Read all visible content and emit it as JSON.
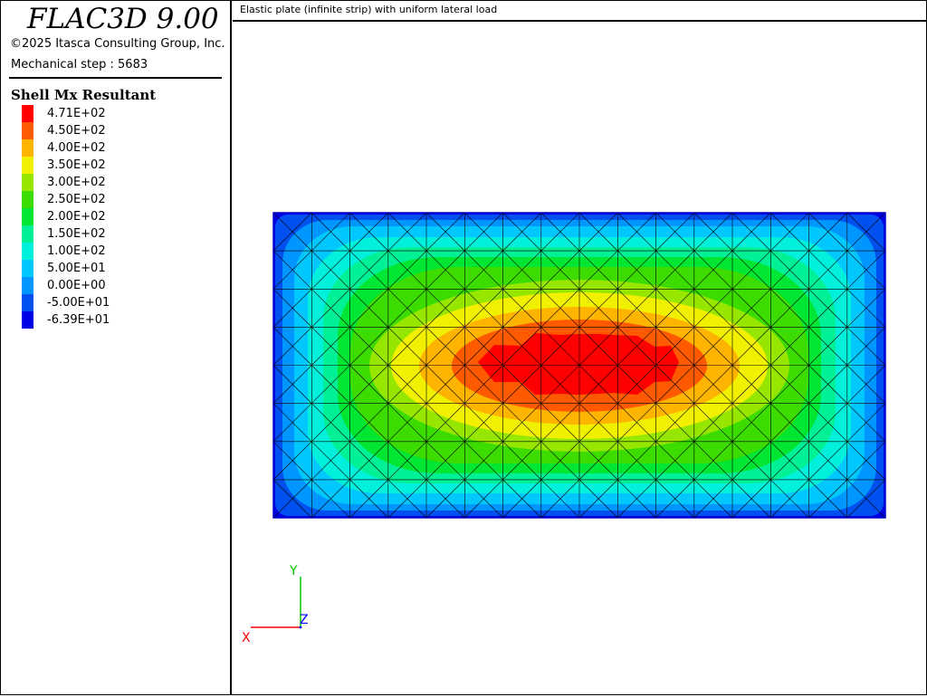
{
  "app": {
    "title": "FLAC3D 9.00",
    "copyright": "©2025 Itasca Consulting Group, Inc.",
    "step": "Mechanical step : 5683"
  },
  "plot": {
    "title": "Elastic plate (infinite strip) with uniform lateral load"
  },
  "legend": {
    "title": "Shell Mx Resultant",
    "items": [
      {
        "label": "4.71E+02",
        "color": "#ff0000"
      },
      {
        "label": "4.50E+02",
        "color": "#ff5a00"
      },
      {
        "label": "4.00E+02",
        "color": "#ffb400"
      },
      {
        "label": "3.50E+02",
        "color": "#f0f000"
      },
      {
        "label": "3.00E+02",
        "color": "#96e600"
      },
      {
        "label": "2.50E+02",
        "color": "#3cdc00"
      },
      {
        "label": "2.00E+02",
        "color": "#00e632"
      },
      {
        "label": "1.50E+02",
        "color": "#00f096"
      },
      {
        "label": "1.00E+02",
        "color": "#00f0dc"
      },
      {
        "label": "5.00E+01",
        "color": "#00c8ff"
      },
      {
        "label": "0.00E+00",
        "color": "#0096ff"
      },
      {
        "label": "-5.00E+01",
        "color": "#0050f0"
      },
      {
        "label": "-6.39E+01",
        "color": "#0000e6"
      }
    ]
  },
  "axes": {
    "x_label": "X",
    "y_label": "Y",
    "z_label": "Z",
    "x_color": "#ff0000",
    "y_color": "#00c800",
    "z_color": "#0000ff"
  }
}
